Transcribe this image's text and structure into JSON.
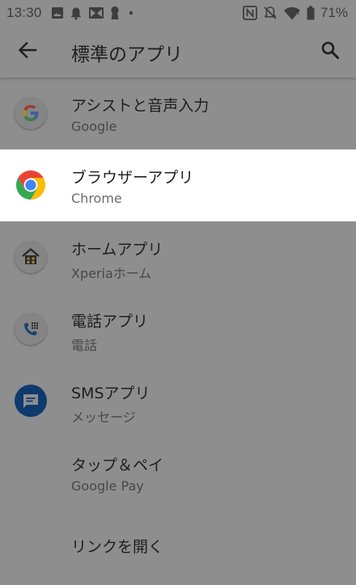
{
  "status_bar": {
    "time": "13:30",
    "battery_percent": "71%",
    "left_icons": [
      "image-icon",
      "notification-bell-icon",
      "mail-icon",
      "keyhole-icon",
      "more-dot-icon"
    ],
    "right_icons": [
      "nfc-icon",
      "notifications-off-icon",
      "wifi-icon",
      "battery-icon"
    ]
  },
  "app_bar": {
    "title": "標準のアプリ",
    "back_icon": "arrow-back-icon",
    "search_icon": "search-icon"
  },
  "items": [
    {
      "title": "アシストと音声入力",
      "subtitle": "Google",
      "icon": "google-g-icon",
      "selected": false
    },
    {
      "title": "ブラウザーアプリ",
      "subtitle": "Chrome",
      "icon": "chrome-icon",
      "selected": true
    },
    {
      "title": "ホームアプリ",
      "subtitle": "Xperiaホーム",
      "icon": "xperia-home-icon",
      "selected": false
    },
    {
      "title": "電話アプリ",
      "subtitle": "電話",
      "icon": "phone-dialer-icon",
      "selected": false
    },
    {
      "title": "SMSアプリ",
      "subtitle": "メッセージ",
      "icon": "messages-icon",
      "selected": false
    },
    {
      "title": "タップ＆ペイ",
      "subtitle": "Google Pay",
      "icon": "",
      "selected": false
    },
    {
      "title": "リンクを開く",
      "subtitle": "",
      "icon": "",
      "selected": false
    }
  ],
  "colors": {
    "scrim_background": "#8e8e8e",
    "selected_row": "#ffffff",
    "google_blue": "#4285f4",
    "google_red": "#ea4335",
    "google_yellow": "#fbbc05",
    "google_green": "#34a853",
    "messages_blue": "#1a5fb4"
  }
}
